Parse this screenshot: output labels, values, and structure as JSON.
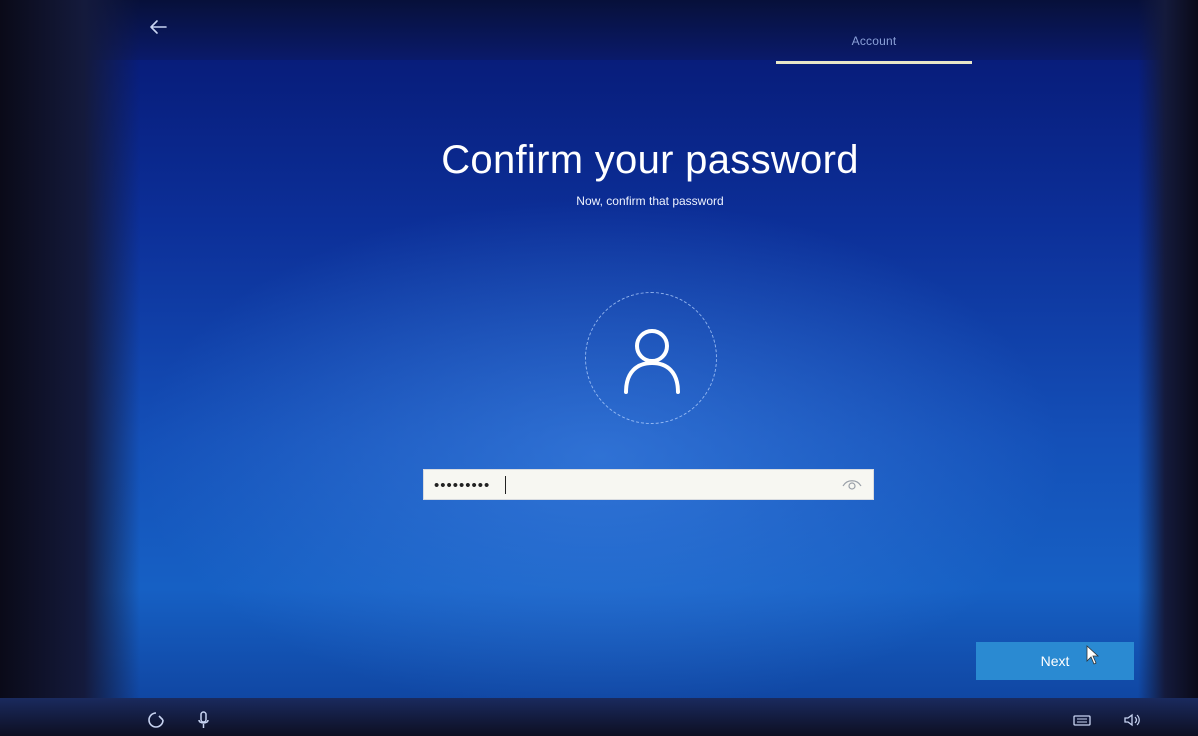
{
  "header": {
    "tabs": [
      {
        "label": "Account",
        "active": true
      }
    ]
  },
  "main": {
    "title": "Confirm your password",
    "subtitle": "Now, confirm that password",
    "password": {
      "value": "•••••••••"
    },
    "next_label": "Next"
  },
  "icons": {
    "back": "back-arrow-icon",
    "avatar": "user-avatar-icon",
    "reveal": "eye-reveal-icon",
    "ease_of_access": "ease-of-access-icon",
    "microphone": "microphone-icon",
    "keyboard": "keyboard-icon",
    "volume": "volume-icon"
  },
  "colors": {
    "background": "#1450b8",
    "accent_button": "#2a8ad2",
    "tab_underline": "#e7e6c8"
  }
}
